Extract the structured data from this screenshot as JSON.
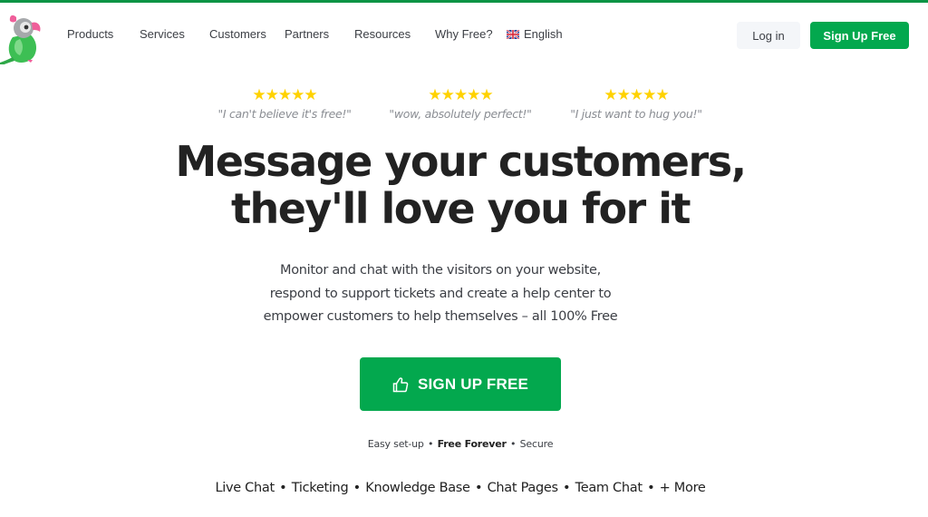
{
  "header": {
    "logo_alt": "parrot-logo",
    "nav": [
      {
        "label": "Products"
      },
      {
        "label": "Services"
      },
      {
        "label": "Customers"
      },
      {
        "label": "Partners"
      },
      {
        "label": "Resources"
      },
      {
        "label": "Why Free?"
      },
      {
        "label": "English",
        "icon": "uk-flag-icon"
      }
    ],
    "login_label": "Log in",
    "signup_label": "Sign Up Free"
  },
  "reviews": [
    {
      "stars": 5,
      "quote": "\"I can't believe it's free!\""
    },
    {
      "stars": 5,
      "quote": "\"wow, absolutely perfect!\""
    },
    {
      "stars": 5,
      "quote": "\"I just want to hug you!\""
    }
  ],
  "hero": {
    "headline_line1": "Message your customers,",
    "headline_line2": "they'll love you for it",
    "subtitle_line1": "Monitor and chat with the visitors on your website,",
    "subtitle_line2": "respond to support tickets and create a help center to",
    "subtitle_line3": "empower customers to help themselves – all 100% Free",
    "cta_label": "SIGN UP FREE",
    "cta_icon": "thumbs-up-icon",
    "tagline": [
      "Easy set-up",
      "Free Forever",
      "Secure"
    ],
    "features": [
      "Live Chat",
      "Ticketing",
      "Knowledge Base",
      "Chat Pages",
      "Team Chat",
      "+ More"
    ]
  },
  "colors": {
    "brand_green": "#03a84e",
    "top_bar": "#0a9445",
    "star": "#ffd200",
    "text_dark": "#222222",
    "text_muted": "#8a8d93"
  }
}
